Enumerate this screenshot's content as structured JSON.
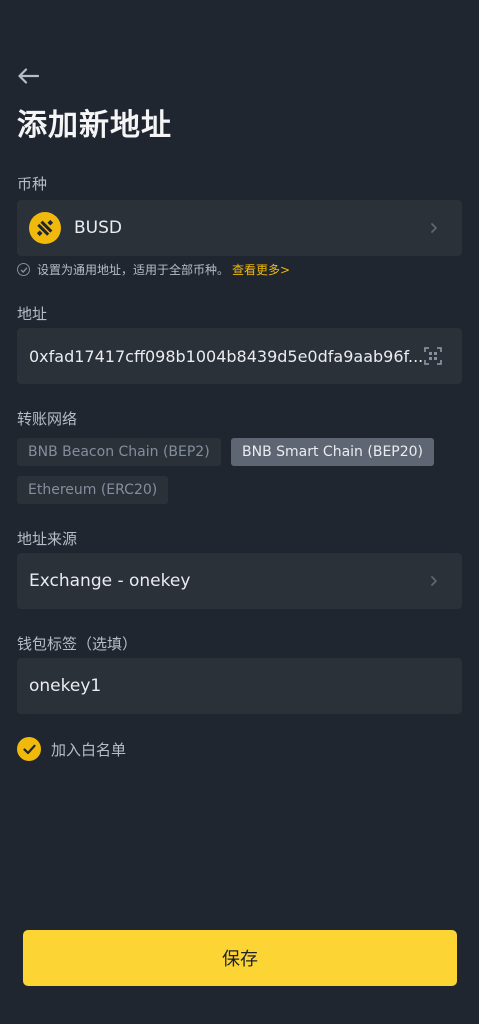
{
  "header": {
    "back_icon": "arrow-left-icon",
    "title": "添加新地址"
  },
  "coin": {
    "label": "币种",
    "value": "BUSD",
    "icon": "busd-icon",
    "hint": "设置为通用地址，适用于全部币种。",
    "hint_link": "查看更多>"
  },
  "address": {
    "label": "地址",
    "value": "0xfad17417cff098b1004b8439d5e0dfa9aab96f..."
  },
  "network": {
    "label": "转账网络",
    "options": [
      {
        "label": "BNB Beacon Chain (BEP2)",
        "selected": false
      },
      {
        "label": "BNB Smart Chain (BEP20)",
        "selected": true
      },
      {
        "label": "Ethereum (ERC20)",
        "selected": false
      }
    ]
  },
  "source": {
    "label": "地址来源",
    "value": "Exchange - onekey"
  },
  "wallet_tag": {
    "label": "钱包标签（选填）",
    "value": "onekey1"
  },
  "whitelist": {
    "label": "加入白名单",
    "checked": true
  },
  "save_label": "保存",
  "colors": {
    "background": "#1f2630",
    "field": "#2b3139",
    "accent": "#f0b90b",
    "button": "#fcd535"
  }
}
